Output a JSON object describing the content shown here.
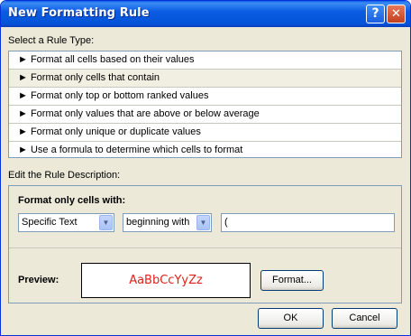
{
  "window": {
    "title": "New Formatting Rule",
    "help_glyph": "?",
    "close_glyph": "✕"
  },
  "rule_type": {
    "label": "Select a Rule Type:",
    "items": [
      {
        "marker": "►",
        "label": "Format all cells based on their values"
      },
      {
        "marker": "►",
        "label": "Format only cells that contain"
      },
      {
        "marker": "►",
        "label": "Format only top or bottom ranked values"
      },
      {
        "marker": "►",
        "label": "Format only values that are above or below average"
      },
      {
        "marker": "►",
        "label": "Format only unique or duplicate values"
      },
      {
        "marker": "►",
        "label": "Use a formula to determine which cells to format"
      }
    ],
    "selected_index": 1
  },
  "description": {
    "label": "Edit the Rule Description:",
    "heading": "Format only cells with:",
    "condition_select": {
      "value": "Specific Text"
    },
    "operator_select": {
      "value": "beginning with"
    },
    "text_value": "(",
    "preview_label": "Preview:",
    "preview_sample": "AaBbCcYyZz",
    "format_button": "Format..."
  },
  "buttons": {
    "ok": "OK",
    "cancel": "Cancel"
  },
  "icons": {
    "dropdown": "chevron-down-icon",
    "list_marker": "triangle-right-icon"
  },
  "colors": {
    "title_bar": "#0a5ee8",
    "preview_text": "#e2201a",
    "dialog_bg": "#ece9d8"
  }
}
